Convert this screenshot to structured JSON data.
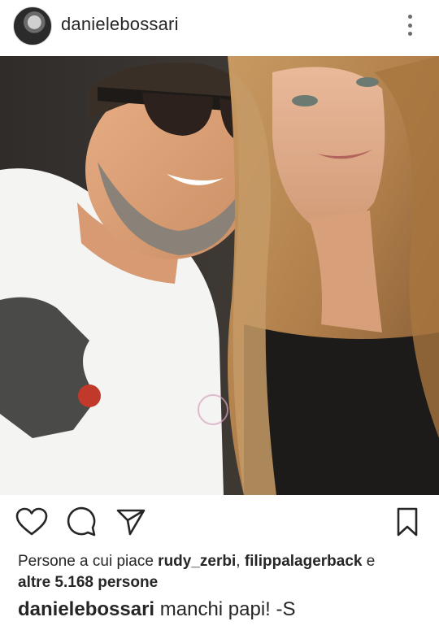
{
  "post": {
    "username": "danielebossari",
    "likes": {
      "prefix": "Persone a cui piace",
      "user1": "rudy_zerbi",
      "separator": ",",
      "user2": "filippalagerback",
      "conjunction": "e",
      "others": "altre 5.168 persone"
    },
    "caption": {
      "username": "danielebossari",
      "text": "manchi papi! -S"
    }
  },
  "icons": {
    "more": "more-vertical-icon",
    "like": "heart-icon",
    "comment": "comment-icon",
    "share": "send-icon",
    "save": "bookmark-icon"
  },
  "colors": {
    "text": "#262626",
    "icon": "#262626",
    "background": "#ffffff"
  }
}
